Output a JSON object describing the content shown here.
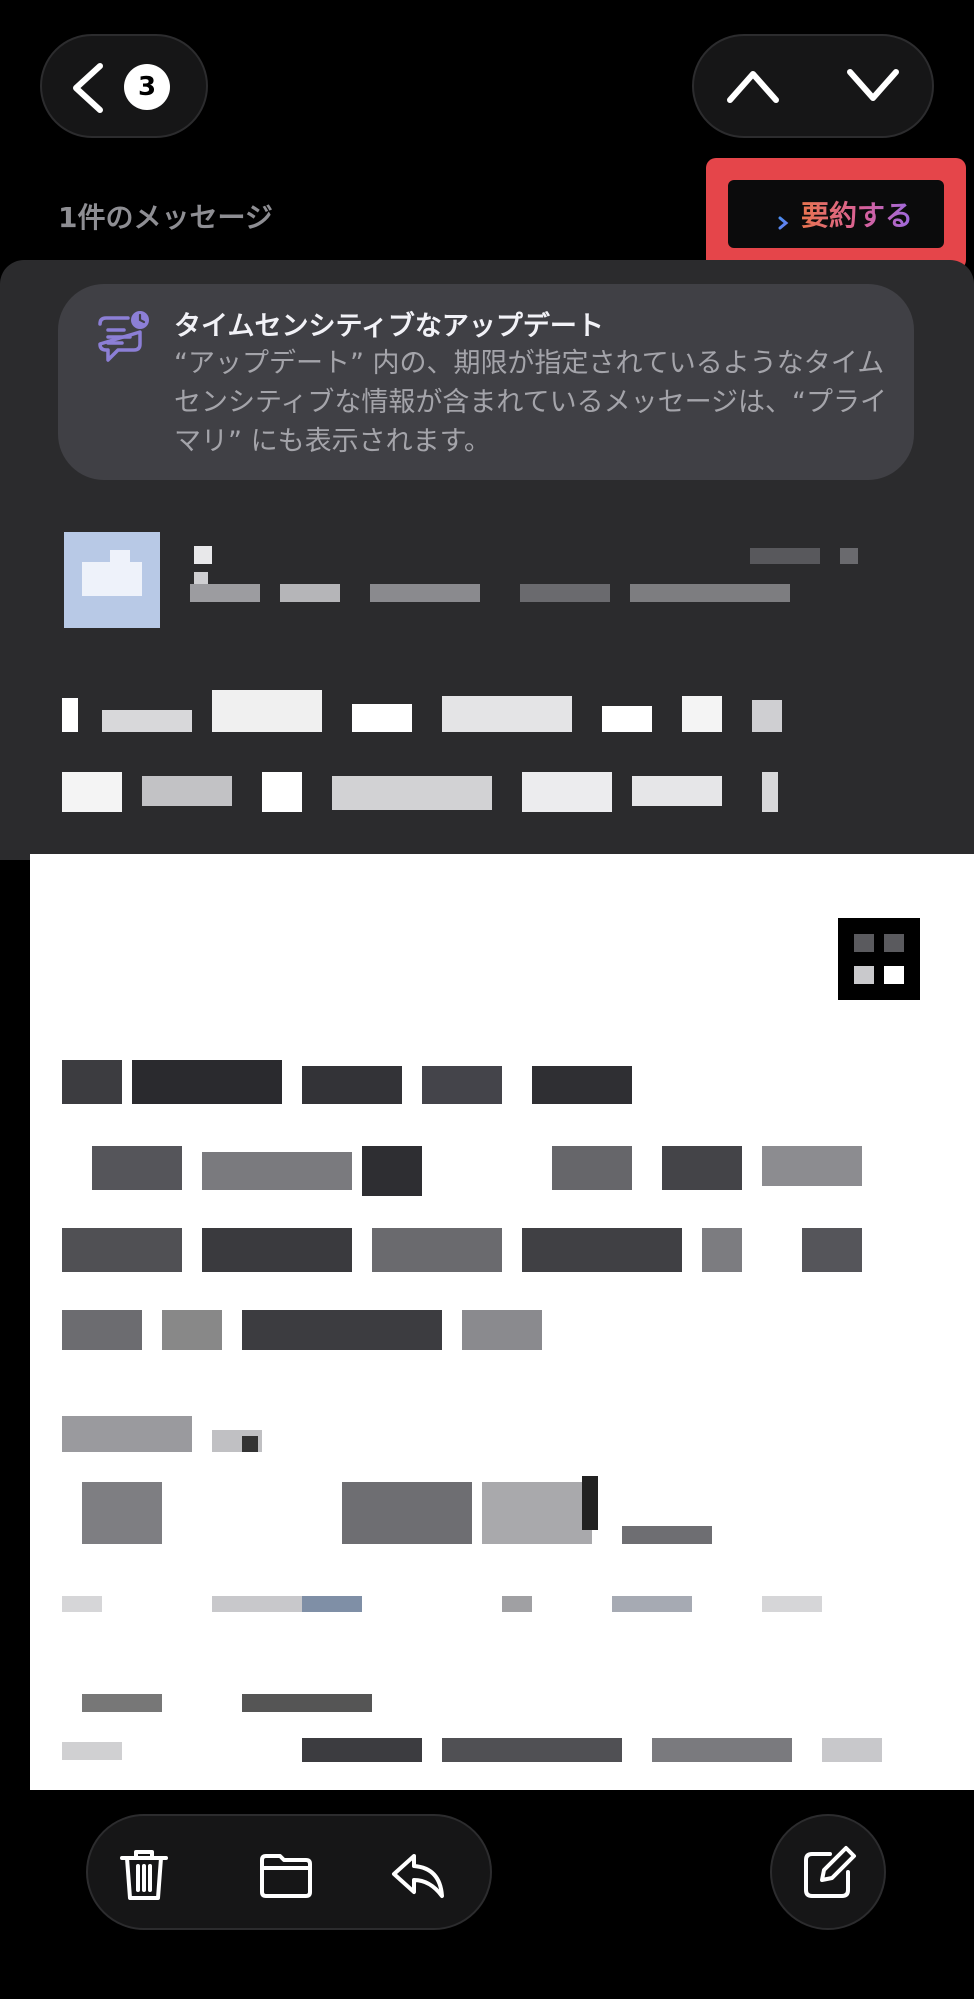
{
  "header": {
    "unread_count": "3",
    "message_count_label": "1件のメッセージ",
    "summarize_label": "要約する"
  },
  "banner": {
    "title": "タイムセンシティブなアップデート",
    "body": "“アップデート” 内の、期限が指定されているようなタイムセンシティブな情報が含まれているメッセージは、“プライマリ” にも表示されます。"
  },
  "icons": {
    "back": "chevron-left-icon",
    "previous": "chevron-up-icon",
    "next": "chevron-down-icon",
    "summarize": "summary-lines-arrow-icon",
    "banner": "chat-bubble-clock-icon",
    "trash": "trash-icon",
    "folder": "folder-icon",
    "reply": "reply-arrow-icon",
    "compose": "compose-square-pencil-icon"
  },
  "colors": {
    "highlight": "#e5454a",
    "card": "#2b2b2d",
    "banner": "#404045",
    "summarize_gradient_start": "#e8744f",
    "summarize_gradient_end": "#9b6ae0"
  }
}
